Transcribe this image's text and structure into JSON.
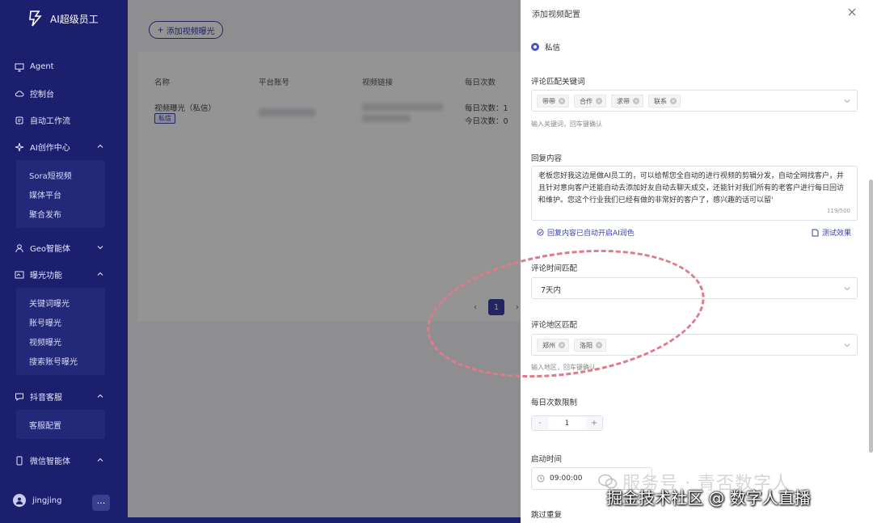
{
  "app": {
    "title": "AI超级员工"
  },
  "sidebar": {
    "items": [
      {
        "label": "Agent",
        "icon": "monitor-icon"
      },
      {
        "label": "控制台",
        "icon": "cloud-icon"
      },
      {
        "label": "自动工作流",
        "icon": "workflow-icon"
      },
      {
        "label": "AI创作中心",
        "icon": "sparkle-icon",
        "sub": [
          "Sora短视频",
          "媒体平台",
          "聚合发布"
        ]
      },
      {
        "label": "Geo智能体",
        "icon": "person-icon"
      },
      {
        "label": "曝光功能",
        "icon": "window-icon",
        "sub": [
          "关键词曝光",
          "账号曝光",
          "视频曝光",
          "搜索账号曝光"
        ]
      },
      {
        "label": "抖音客服",
        "icon": "chat-icon",
        "sub": [
          "客服配置"
        ]
      },
      {
        "label": "微信智能体",
        "icon": "phone-icon"
      }
    ],
    "user": {
      "name": "jingjing",
      "more": "···"
    }
  },
  "main": {
    "add_button": "添加视频曝光",
    "columns": [
      "名称",
      "平台账号",
      "视频链接",
      "每日次数"
    ],
    "row": {
      "name": "视频曝光（私信）",
      "tag": "私信",
      "daily_count": "每日次数：1",
      "today_count": "今日次数：0"
    },
    "pager": {
      "prev": "‹",
      "current": "1",
      "next": "›"
    }
  },
  "drawer": {
    "title": "添加视频配置",
    "radio": {
      "label": "私信",
      "checked": true
    },
    "keywords": {
      "label": "评论匹配关键词",
      "tags": [
        "带带",
        "合作",
        "求带",
        "联系"
      ],
      "hint": "输入关键词，回车键确认"
    },
    "reply": {
      "label": "回复内容",
      "text": "老板您好我这边是做AI员工的，可以给帮您全自动的进行视频的剪辑分发，自动全网找客户，并且针对意向客户还能自动去添加好友自动去聊天成交，还能针对我们所有的老客户进行每日回访和维护。您这个行业我们已经有做的非常好的客户了，感兴趣的话可以留'",
      "counter": "119/500",
      "ai_note": "回复内容已自动开启AI润色",
      "test_link": "测试效果"
    },
    "time_match": {
      "label": "评论时间匹配",
      "value": "7天内"
    },
    "region_match": {
      "label": "评论地区匹配",
      "tags": [
        "郑州",
        "洛阳"
      ],
      "hint": "输入地区，回车键确认"
    },
    "daily_limit": {
      "label": "每日次数限制",
      "value": "1",
      "minus": "-",
      "plus": "+"
    },
    "start_time": {
      "label": "启动时间",
      "value": "09:00:00"
    },
    "skip_dup": {
      "label": "跳过重复"
    }
  },
  "watermarks": {
    "line1": "服务号 · 青否数字人",
    "line2": "掘金技术社区 @ 数字人直播"
  },
  "colors": {
    "sidebar_bg": "#1c1f6e",
    "accent": "#3b40a6",
    "annotation": "#e07a8c"
  }
}
